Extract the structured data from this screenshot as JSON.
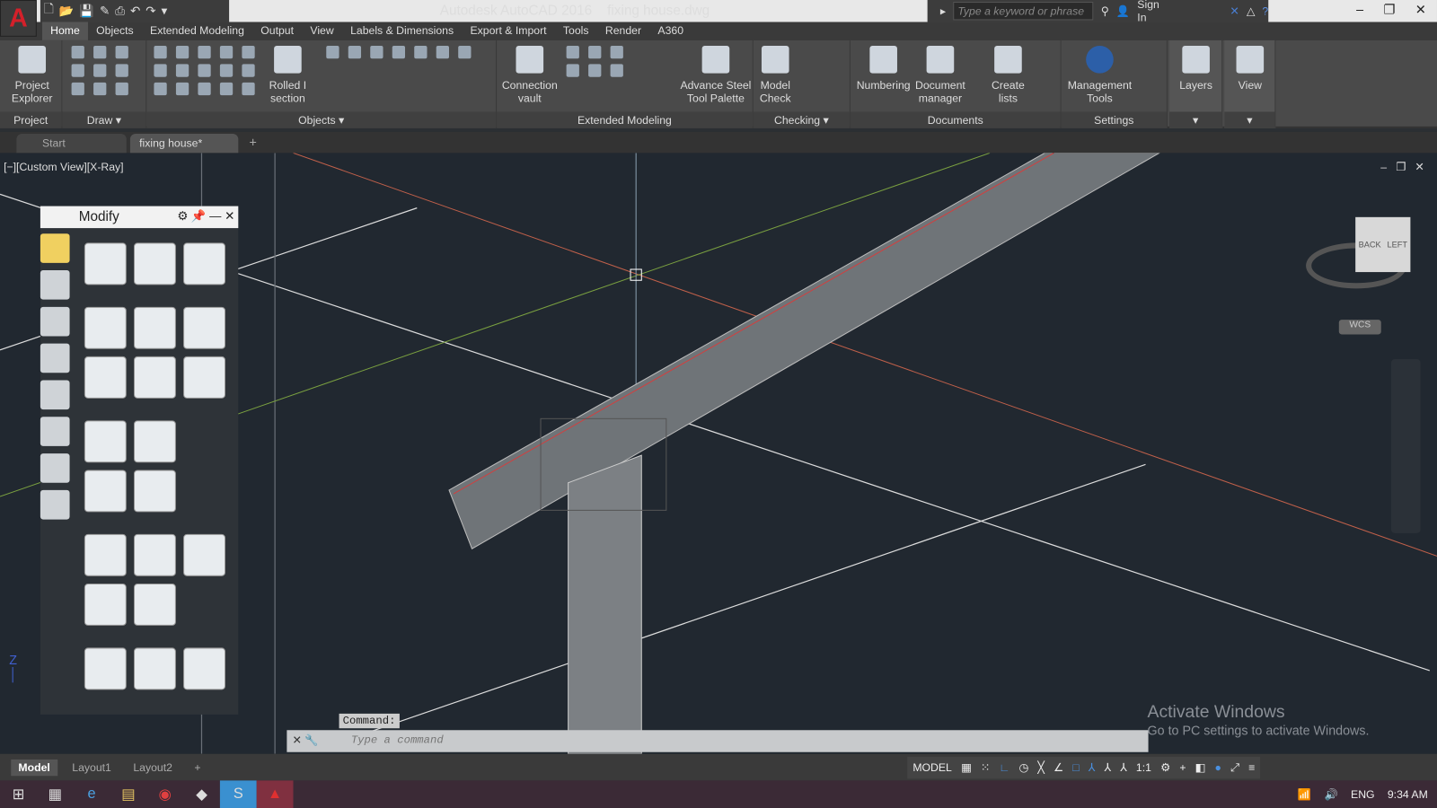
{
  "app": {
    "title": "Autodesk AutoCAD 2016",
    "file": "fixing house.dwg",
    "logo": "A"
  },
  "search": {
    "placeholder": "Type a keyword or phrase",
    "signin": "Sign In"
  },
  "menu_tabs": [
    "Home",
    "Objects",
    "Extended Modeling",
    "Output",
    "View",
    "Labels & Dimensions",
    "Export & Import",
    "Tools",
    "Render",
    "A360"
  ],
  "ribbon": {
    "panels": [
      "Project",
      "Draw",
      "Objects",
      "Extended Modeling",
      "Checking",
      "Documents",
      "Settings"
    ],
    "buttons": {
      "project_explorer": "Project Explorer",
      "rolled_section": "Rolled I section",
      "connection_vault": "Connection vault",
      "advance_steel": "Advance Steel Tool Palette",
      "model_check": "Model Check",
      "numbering": "Numbering",
      "document_manager": "Document manager",
      "create_lists": "Create lists",
      "management_tools": "Management Tools",
      "layers": "Layers",
      "view": "View"
    }
  },
  "doc_tabs": [
    "Start",
    "fixing house*"
  ],
  "viewport": {
    "label": "[−][Custom View][X-Ray]",
    "wcs": "WCS",
    "cube_back": "BACK",
    "cube_left": "LEFT"
  },
  "palette": {
    "title": "Modify"
  },
  "command": {
    "label": "Command:",
    "placeholder": "Type a command"
  },
  "activate": {
    "line1": "Activate Windows",
    "line2": "Go to PC settings to activate Windows."
  },
  "layout_tabs": [
    "Model",
    "Layout1",
    "Layout2"
  ],
  "status": {
    "model": "MODEL",
    "scale": "1:1"
  },
  "tray": {
    "lang": "ENG",
    "time": "9:34 AM"
  },
  "colors": {
    "viewport_bg": "#212830",
    "accent_red": "#d4202a",
    "taskbar": "#3b2a36"
  }
}
